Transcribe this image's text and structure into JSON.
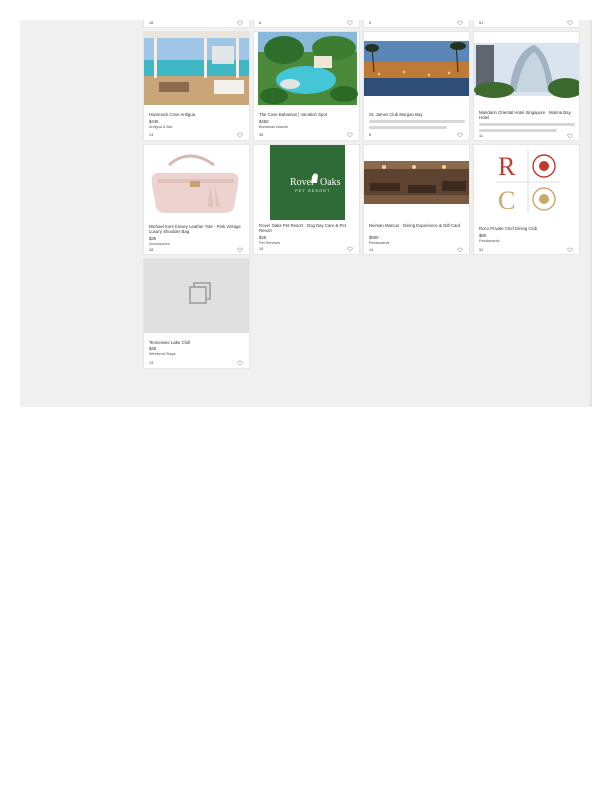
{
  "colors": {
    "background": "#f0f0f0",
    "card": "#ffffff",
    "placeholder_bar": "#d6d6d6",
    "roco_red": "#c0392b",
    "roco_gold": "#c8a96e",
    "rover_green": "#2e6b36"
  },
  "top_row_stubs": [
    {
      "count": "16"
    },
    {
      "count": "6"
    },
    {
      "count": "5"
    },
    {
      "count": "51"
    }
  ],
  "cards": [
    {
      "title": "Hammock Cove Antigua",
      "price": "$445",
      "meta": "Antigua & Bar.",
      "count": "13",
      "icon": "heart-icon"
    },
    {
      "title": "The Cove Bahamas | Vacation Spot",
      "price": "$450",
      "meta": "Bahamas Islands",
      "count": "36",
      "icon": "heart-icon"
    },
    {
      "title": "St. James Club Morgan Bay",
      "price": "",
      "meta": "",
      "count": "8",
      "icon": "heart-icon"
    },
    {
      "title": "Mandarin Oriental Hotel Singapore · Marina Bay Hotel",
      "price": "",
      "meta": "",
      "count": "11",
      "icon": "heart-icon"
    },
    {
      "title": "Michael Kors Kinsey Leather Tote - Pink Vintage Luxury Shoulder Bag",
      "price": "$35",
      "meta": "Accessories",
      "count": "28",
      "icon": "heart-icon"
    },
    {
      "title": "Rover Oaks Pet Resort · Dog Day Care & Pet Resort",
      "price": "$45",
      "meta": "Pet Services",
      "count": "15",
      "icon": "heart-icon",
      "logo_text_1": "Rover",
      "logo_text_2": "Oaks",
      "logo_sub": "PET RESORT"
    },
    {
      "title": "Neiman Marcus · Dining Experience & Gift Card",
      "price": "$500",
      "meta": "Restaurants",
      "count": "14",
      "icon": "heart-icon"
    },
    {
      "title": "Roco Private Chef Dining Club",
      "price": "$80",
      "meta": "Restaurants",
      "count": "31",
      "icon": "heart-icon",
      "logo_letters": [
        "R",
        "C",
        "O"
      ]
    },
    {
      "title": "Tennessee Lake Chill",
      "price": "$45",
      "meta": "Weekend Stays",
      "count": "13",
      "icon": "heart-icon",
      "placeholder_icon": "copy-icon"
    }
  ]
}
